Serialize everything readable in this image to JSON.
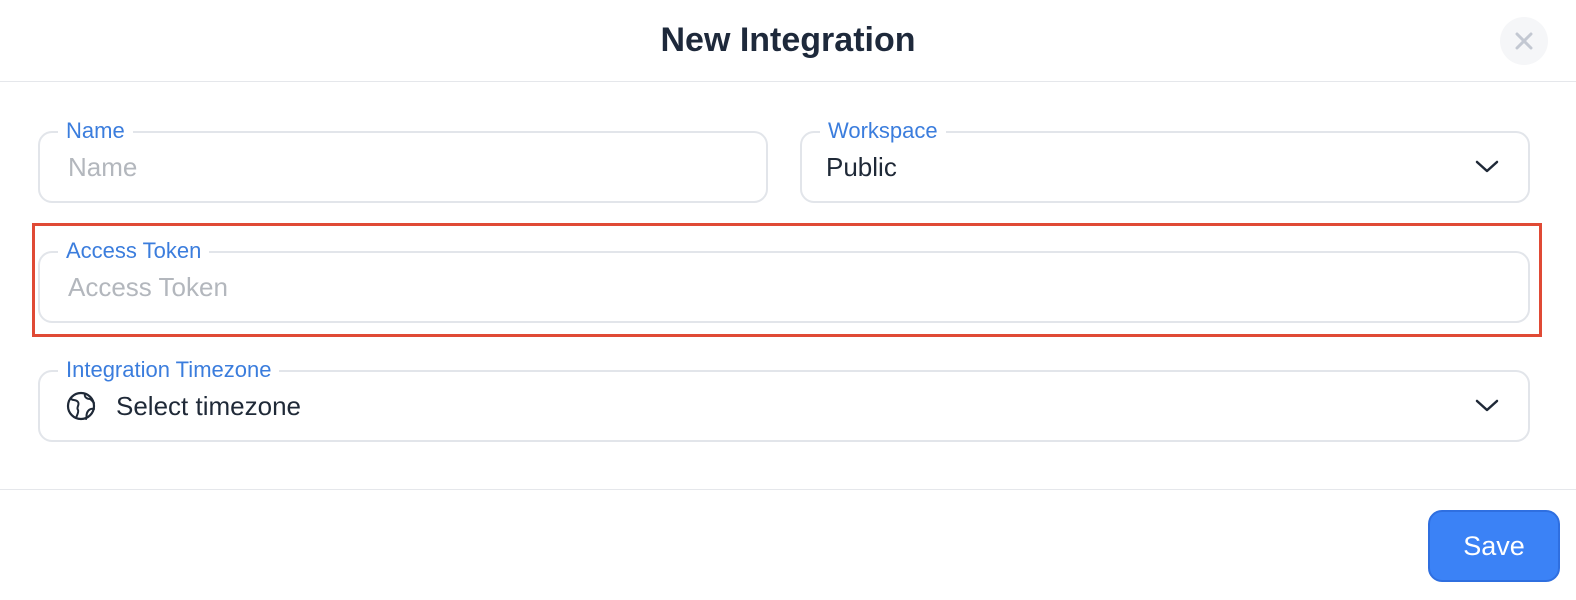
{
  "dialog": {
    "title": "New Integration",
    "close_icon": "close-icon"
  },
  "form": {
    "name": {
      "label": "Name",
      "placeholder": "Name",
      "value": ""
    },
    "workspace": {
      "label": "Workspace",
      "selected": "Public",
      "icon": "chevron-down-icon"
    },
    "access_token": {
      "label": "Access Token",
      "placeholder": "Access Token",
      "value": ""
    },
    "timezone": {
      "label": "Integration Timezone",
      "selected": "Select timezone",
      "icon": "globe-icon",
      "dropdown_icon": "chevron-down-icon"
    }
  },
  "footer": {
    "save_label": "Save"
  },
  "colors": {
    "label": "#3b7ddd",
    "primary_button": "#3b82f6",
    "highlight": "#e04a35",
    "field_border": "#e2e5ea"
  }
}
